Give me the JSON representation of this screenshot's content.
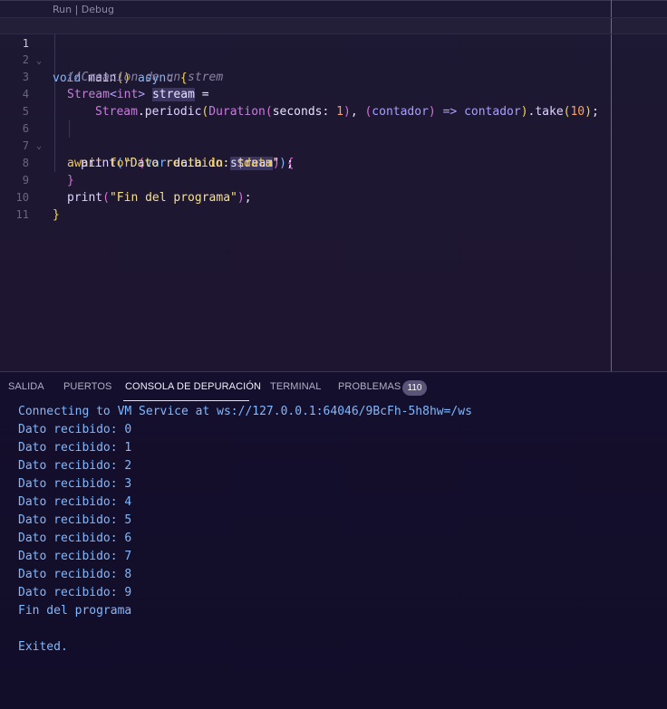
{
  "editor": {
    "codelens": "Run | Debug",
    "line_numbers": [
      "1",
      "2",
      "3",
      "4",
      "5",
      "6",
      "7",
      "8",
      "9",
      "10",
      "11"
    ],
    "lines": {
      "l1": {
        "void": "void",
        "main": "main",
        "parens": "()",
        "async": "async",
        "brace": "{"
      },
      "l2": {
        "comment": "//Creacion de un strem"
      },
      "l3": {
        "type": "Stream",
        "generic_open": "<",
        "int": "int",
        "generic_close": ">",
        "var": "stream",
        "eq": " ="
      },
      "l4": {
        "type": "Stream",
        "dot": ".",
        "method": "periodic",
        "p1": "(",
        "duration": "Duration",
        "p2": "(",
        "seconds": "seconds:",
        "one": "1",
        "p3": ")",
        "comma": ", ",
        "p4": "(",
        "param": "contador",
        "p5": ")",
        "arrow": " => ",
        "body": "contador",
        "p6": ")",
        "dot2": ".",
        "take": "take",
        "p7": "(",
        "ten": "10",
        "p8": ")",
        "semi": ";"
      },
      "l6": {
        "await": "await",
        "for": "for",
        "p1": "(",
        "var": "var",
        "data": "data",
        "in": "in",
        "stream": "stream",
        "p2": ")",
        "brace": "{"
      },
      "l7": {
        "print": "print",
        "p1": "(",
        "str": "\"Dato recibido: ",
        "interp": "$data",
        "strend": "\"",
        "p2": ")",
        "semi": ";"
      },
      "l8": {
        "brace": "}"
      },
      "l9": {
        "print": "print",
        "p1": "(",
        "str": "\"Fin del programa\"",
        "p2": ")",
        "semi": ";"
      },
      "l10": {
        "brace": "}"
      }
    }
  },
  "panel": {
    "tabs": [
      {
        "label": "SALIDA"
      },
      {
        "label": "PUERTOS"
      },
      {
        "label": "CONSOLA DE DEPURACIÓN"
      },
      {
        "label": "TERMINAL"
      },
      {
        "label": "PROBLEMAS"
      }
    ],
    "problems_count": "110",
    "console_lines": [
      "Connecting to VM Service at ws://127.0.0.1:64046/9BcFh-5h8hw=/ws",
      "Dato recibido: 0",
      "Dato recibido: 1",
      "Dato recibido: 2",
      "Dato recibido: 3",
      "Dato recibido: 4",
      "Dato recibido: 5",
      "Dato recibido: 6",
      "Dato recibido: 7",
      "Dato recibido: 8",
      "Dato recibido: 9",
      "Fin del programa",
      "",
      "Exited."
    ]
  },
  "colors": {
    "background": "#1d1630",
    "console_text": "#7fb9ff",
    "keyword": "#f2c94c"
  }
}
